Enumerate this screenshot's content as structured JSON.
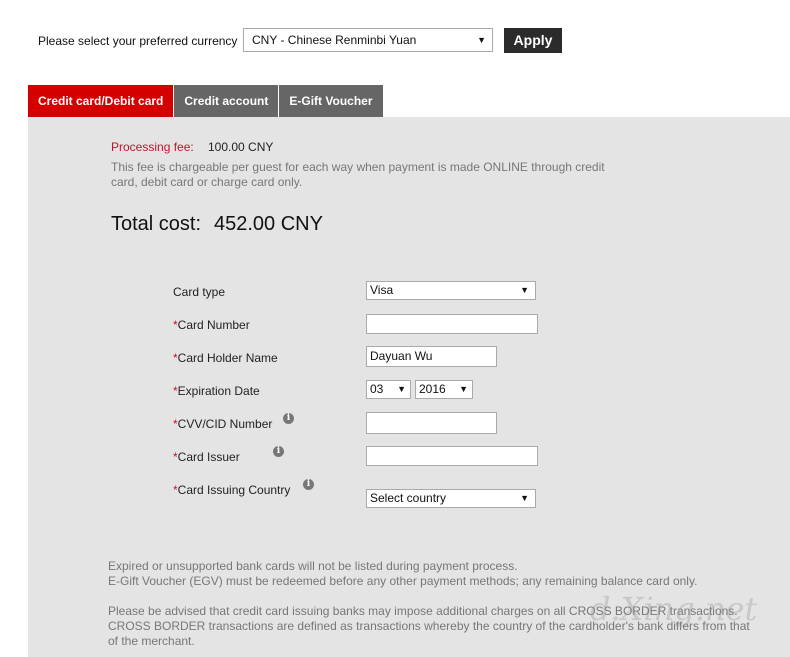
{
  "currency": {
    "label": "Please select your preferred currency",
    "selected": "CNY - Chinese Renminbi Yuan",
    "apply_label": "Apply"
  },
  "tabs": [
    {
      "label": "Credit card/Debit card",
      "active": true
    },
    {
      "label": "Credit account",
      "active": false
    },
    {
      "label": "E-Gift Voucher",
      "active": false
    }
  ],
  "fee": {
    "label": "Processing fee:",
    "value": "100.00 CNY",
    "note": "This fee is chargeable per guest for each way when payment is made ONLINE through credit card, debit card or charge card only."
  },
  "total": {
    "label": "Total cost:",
    "value": "452.00 CNY"
  },
  "form": {
    "card_type_label": "Card type",
    "card_type_value": "Visa",
    "card_number_label": "Card Number",
    "card_number_value": "",
    "holder_label": "Card Holder Name",
    "holder_value": "Dayuan Wu",
    "expiration_label": "Expiration Date",
    "exp_month": "03",
    "exp_year": "2016",
    "cvv_label": "CVV/CID Number",
    "cvv_value": "",
    "issuer_label": "Card Issuer",
    "issuer_value": "",
    "country_label": "Card Issuing Country",
    "country_value": "Select country",
    "required_mark": "*",
    "info_glyph": "i"
  },
  "footer": {
    "line1": "Expired or unsupported bank cards will not be listed during payment process.",
    "line2": "E-Gift Voucher (EGV) must be redeemed before any other payment methods; any remaining balance card only.",
    "line3": "Please be advised that credit card issuing banks may impose additional charges on all CROSS BORDER transactions. CROSS BORDER transactions are defined as transactions whereby the country of the cardholder's bank differs from that of the merchant."
  },
  "watermark": "d.Xing.net",
  "colors": {
    "accent_red": "#d40000",
    "tab_gray": "#666666",
    "panel_bg": "#e4e4e4",
    "apply_bg": "#2b2b2b"
  }
}
